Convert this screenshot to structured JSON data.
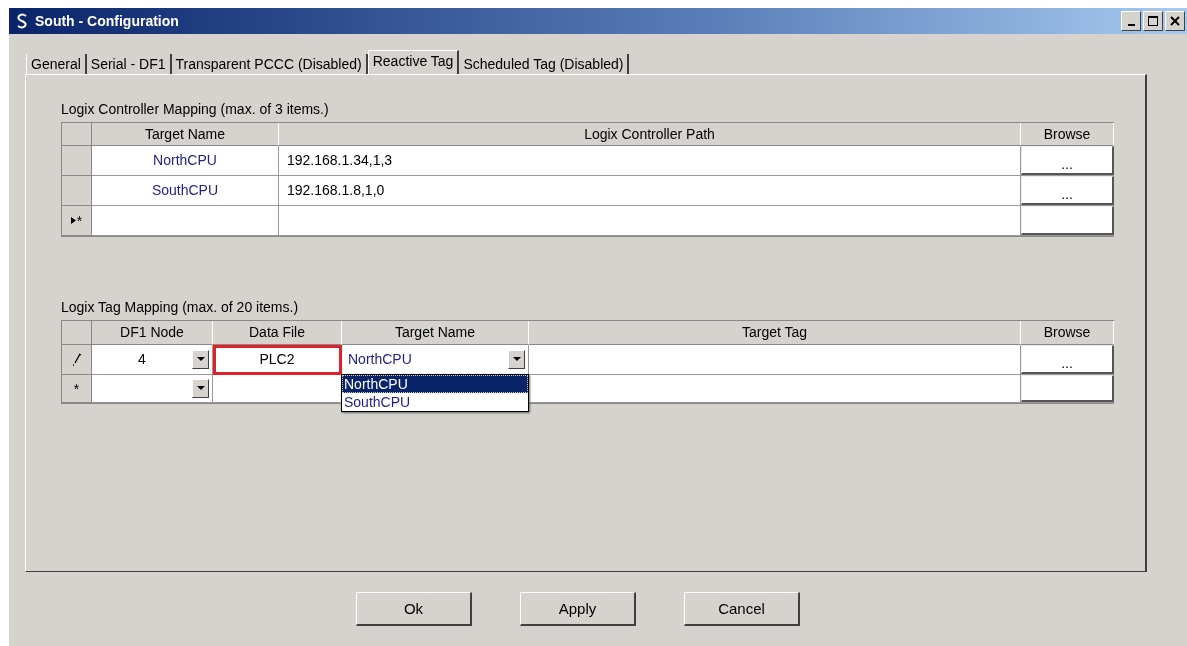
{
  "window": {
    "title": "South - Configuration"
  },
  "tabs": [
    {
      "label": "General",
      "selected": false
    },
    {
      "label": "Serial - DF1",
      "selected": false
    },
    {
      "label": "Transparent PCCC (Disabled)",
      "selected": false
    },
    {
      "label": "Reactive Tag",
      "selected": true
    },
    {
      "label": "Scheduled Tag (Disabled)",
      "selected": false
    }
  ],
  "controller_mapping": {
    "title": "Logix Controller Mapping (max. of 3 items.)",
    "columns": [
      "Target Name",
      "Logix Controller Path",
      "Browse"
    ],
    "rows": [
      {
        "kind": "data",
        "target_name": "NorthCPU",
        "path": "192.168.1.34,1,3",
        "browse": "..."
      },
      {
        "kind": "data",
        "target_name": "SouthCPU",
        "path": "192.168.1.8,1,0",
        "browse": "..."
      },
      {
        "kind": "new",
        "marker": "*",
        "current": true
      }
    ]
  },
  "tag_mapping": {
    "title": "Logix Tag Mapping (max. of 20 items.)",
    "columns": [
      "DF1 Node",
      "Data File",
      "Target Name",
      "Target Tag",
      "Browse"
    ],
    "rows": [
      {
        "kind": "editing",
        "df1_node": "4",
        "data_file": "PLC2",
        "highlighted": true,
        "target_name": "NorthCPU",
        "browse": "..."
      },
      {
        "kind": "new",
        "marker": "*",
        "current": false
      }
    ],
    "dropdown": {
      "options": [
        {
          "label": "NorthCPU",
          "selected": true
        },
        {
          "label": "SouthCPU",
          "selected": false
        }
      ]
    }
  },
  "buttons": [
    "Ok",
    "Apply",
    "Cancel"
  ]
}
